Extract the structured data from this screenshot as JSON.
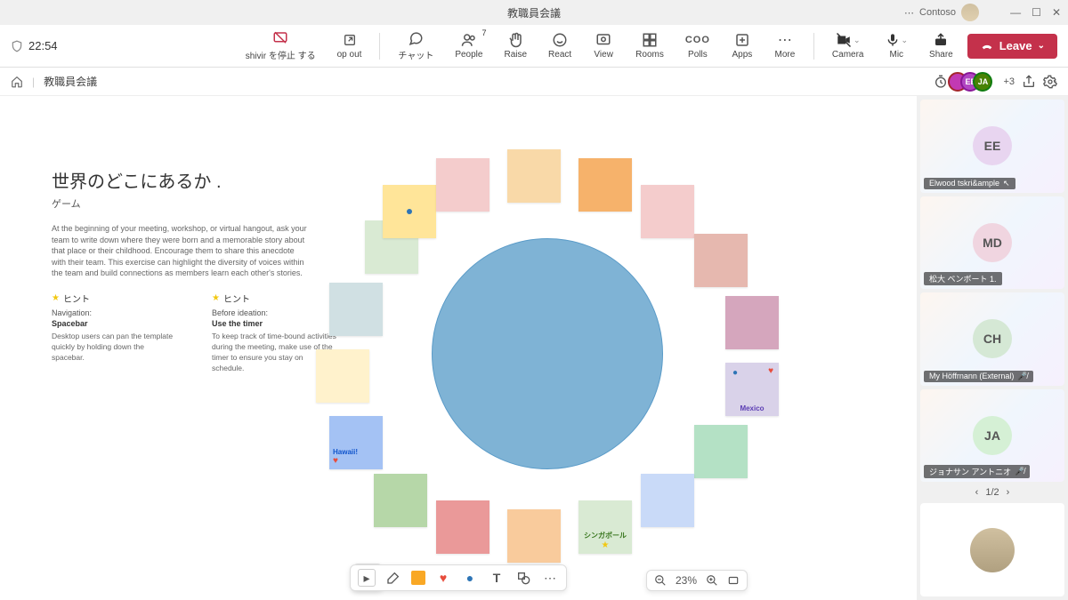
{
  "titlebar": {
    "title": "教職員会議",
    "org": "Contoso"
  },
  "meeting": {
    "time": "22:54",
    "sharing_stop": "shivir を停止 する",
    "popout": "op out",
    "chat": "チャット",
    "people": "People",
    "people_count": "7",
    "raise": "Raise",
    "react": "React",
    "view": "View",
    "rooms": "Rooms",
    "polls": "Polls",
    "polls_sym": "COO",
    "apps": "Apps",
    "more": "More",
    "camera": "Camera",
    "mic": "Mic",
    "share": "Share",
    "leave": "Leave"
  },
  "subheader": {
    "title": "教職員会議",
    "plus": "+3"
  },
  "whiteboard": {
    "title": "世界のどこにあるか .",
    "subtitle": "ゲーム",
    "desc": "At the beginning of your meeting, workshop, or virtual hangout, ask your team to write down where they were born and a memorable story about that place or their childhood. Encourage them to share this anecdote with their team. This exercise can highlight the diversity of voices within the team and build connections as members learn each other's stories.",
    "hint1": {
      "label": "ヒント",
      "t": "Navigation:",
      "b": "Spacebar",
      "d": "Desktop users can pan the template quickly by holding down the spacebar."
    },
    "hint2": {
      "label": "ヒント",
      "t": "Before ideation:",
      "b": "Use the timer",
      "d": "To keep track of time-bound activities during the meeting, make use of the timer to ensure you stay on schedule."
    },
    "notes": {
      "hawaii": "Hawaii!",
      "mexico": "Mexico",
      "singapore": "シンガポール"
    },
    "zoom": "23%"
  },
  "participants": [
    {
      "initials": "EE",
      "name": "Elwood tskri&ample",
      "bg": "#e8d5f0"
    },
    {
      "initials": "MD",
      "name": "松大 ベンボート 1.",
      "bg": "#f0d5e0"
    },
    {
      "initials": "CH",
      "name": "My Höffrnann (External)",
      "bg": "#d5e8d5"
    },
    {
      "initials": "JA",
      "name": "ジョナサン アントニオ",
      "bg": "#d5f0d5"
    }
  ],
  "pager": "1/2"
}
